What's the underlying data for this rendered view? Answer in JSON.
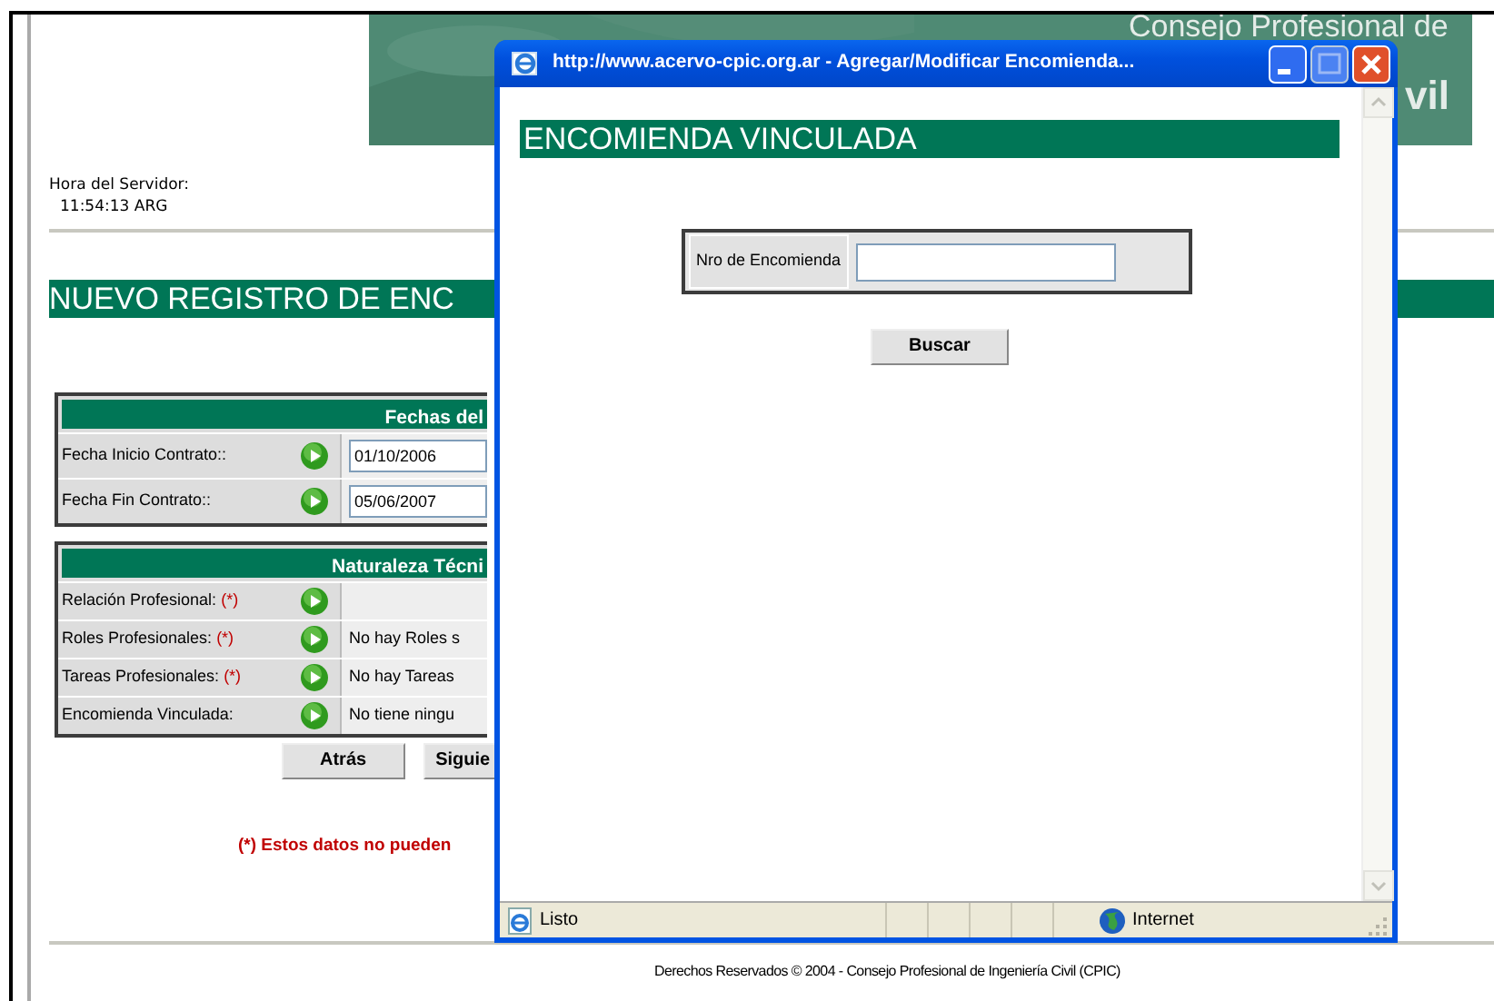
{
  "page": {
    "banner": {
      "kind": "picture",
      "texts": [
        "Consejo Profesional de",
        "vil"
      ]
    },
    "server_time_label": "Hora del Servidor:",
    "server_time": "11:54:13 ARG",
    "title": "NUEVO REGISTRO DE ENC",
    "sections": [
      {
        "header": "Fechas del",
        "rows": [
          {
            "label": "Fecha Inicio Contrato::",
            "kind": "input",
            "value": "01/10/2006"
          },
          {
            "label": "Fecha Fin Contrato::",
            "kind": "input",
            "value": "05/06/2007"
          }
        ]
      },
      {
        "header": "Naturaleza Técni",
        "rows": [
          {
            "label": "Relación Profesional:",
            "required_mark": "(*)",
            "kind": "text"
          },
          {
            "label": "Roles Profesionales:",
            "required_mark": "(*)",
            "kind": "text",
            "value": "No hay Roles s"
          },
          {
            "label": "Tareas Profesionales:",
            "required_mark": "(*)",
            "kind": "text",
            "value": "No hay Tareas"
          },
          {
            "label": "Encomienda Vinculada:",
            "kind": "text",
            "value": "No tiene ningu"
          }
        ]
      }
    ],
    "buttons": [
      "Atrás",
      "Siguie"
    ],
    "note": "(*) Estos datos no pueden",
    "footer": "Derechos Reservados © 2004 - Consejo Profesional de Ingeniería Civil (CPIC)"
  },
  "popup": {
    "title": "http://www.acervo-cpic.org.ar - Agregar/Modificar Encomienda...",
    "heading": "ENCOMIENDA VINCULADA",
    "field": {
      "label": "Nro de Encomienda"
    },
    "button": "Buscar",
    "status": "Listo",
    "zone": "Internet"
  }
}
